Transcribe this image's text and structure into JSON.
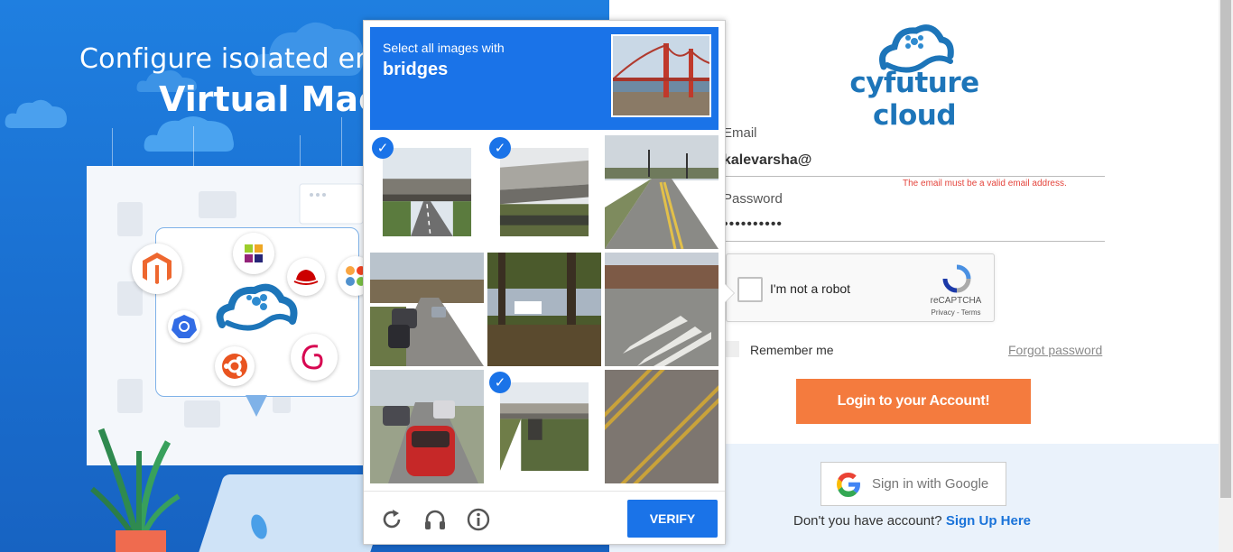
{
  "promo": {
    "headline": "Configure isolated envi",
    "title": "Virtual Mach"
  },
  "brand": {
    "name": "cyfuture cloud",
    "primary_color": "#1d75b9"
  },
  "login_form": {
    "email_label": "Email",
    "email_value": "kalevarsha@",
    "email_error": "The email must be a valid email address.",
    "password_label": "Password",
    "password_value": "••••••••••",
    "recaptcha_label": "I'm not a robot",
    "recaptcha_brand": "reCAPTCHA",
    "recaptcha_links": "Privacy - Terms",
    "remember_label": "Remember me",
    "forgot_label": "Forgot password",
    "login_button": "Login to your Account!",
    "google_button": "Sign in with Google",
    "signup_prompt": "Don't you have account?",
    "signup_link": "Sign Up Here",
    "accent_color": "#f47b3e"
  },
  "challenge": {
    "instruction": "Select all images with",
    "target": "bridges",
    "verify_label": "VERIFY",
    "accent_color": "#1a73e8",
    "tiles": [
      {
        "scene": "overpass",
        "selected": true
      },
      {
        "scene": "bridge-underside",
        "selected": true
      },
      {
        "scene": "road-intersection",
        "selected": false
      },
      {
        "scene": "street-cars",
        "selected": false
      },
      {
        "scene": "trees-lake",
        "selected": false
      },
      {
        "scene": "crosswalk",
        "selected": false
      },
      {
        "scene": "traffic-red-car",
        "selected": false
      },
      {
        "scene": "overpass-grass",
        "selected": true
      },
      {
        "scene": "road-lines",
        "selected": false
      }
    ],
    "footer_icons": [
      "reload-icon",
      "headphones-icon",
      "info-icon"
    ]
  }
}
